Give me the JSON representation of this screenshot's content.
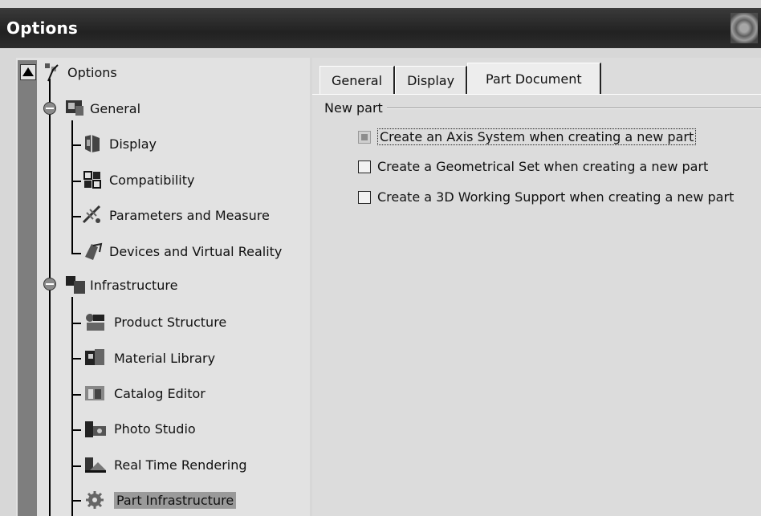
{
  "window": {
    "title": "Options"
  },
  "tree": {
    "root": {
      "label": "Options",
      "icon": "options-tree-icon"
    },
    "groups": [
      {
        "label": "General",
        "icon": "general-icon",
        "children": [
          {
            "label": "Display",
            "icon": "display-icon"
          },
          {
            "label": "Compatibility",
            "icon": "compatibility-icon"
          },
          {
            "label": "Parameters and Measure",
            "icon": "parameters-icon"
          },
          {
            "label": "Devices and Virtual Reality",
            "icon": "devices-icon"
          }
        ]
      },
      {
        "label": "Infrastructure",
        "icon": "infrastructure-icon",
        "children": [
          {
            "label": "Product Structure",
            "icon": "product-structure-icon"
          },
          {
            "label": "Material Library",
            "icon": "material-library-icon"
          },
          {
            "label": "Catalog Editor",
            "icon": "catalog-editor-icon"
          },
          {
            "label": "Photo Studio",
            "icon": "photo-studio-icon"
          },
          {
            "label": "Real Time Rendering",
            "icon": "rendering-icon"
          },
          {
            "label": "Part Infrastructure",
            "icon": "gear-icon",
            "selected": true
          }
        ]
      }
    ]
  },
  "tabs": [
    {
      "label": "General"
    },
    {
      "label": "Display"
    },
    {
      "label": "Part Document",
      "active": true
    }
  ],
  "new_part": {
    "label": "New part",
    "options": [
      {
        "label": "Create an Axis System when creating a new part",
        "checked": false,
        "greyed": true,
        "focused": true
      },
      {
        "label": "Create a Geometrical Set when creating a new part",
        "checked": false
      },
      {
        "label": "Create a 3D Working Support when creating a new part",
        "checked": false
      }
    ]
  }
}
